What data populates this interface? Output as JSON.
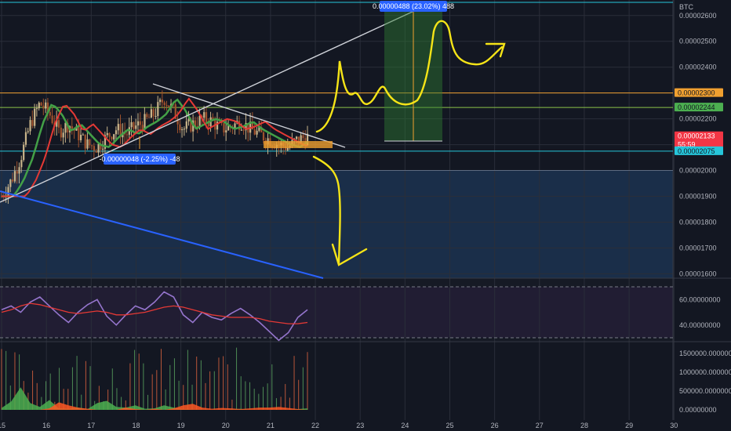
{
  "chart_data": [
    {
      "type": "candlestick",
      "currency_label": "BTC",
      "x_ticks": [
        "15",
        "16",
        "17",
        "18",
        "19",
        "20",
        "21",
        "22",
        "23",
        "24",
        "25",
        "26",
        "27",
        "28",
        "29",
        "30"
      ],
      "y_ticks": [
        "0.00002600",
        "0.00002500",
        "0.00002400",
        "0.00002300",
        "0.00002200",
        "0.00002100",
        "0.00002000",
        "0.00001900",
        "0.00001800",
        "0.00001700",
        "0.00001600"
      ],
      "ylim": [
        1.58e-05,
        2.66e-05
      ],
      "price_tags": [
        {
          "value": "0.00002300",
          "color": "#f0a030",
          "text_color": "#131722"
        },
        {
          "value": "0.00002244",
          "color": "#4caf50",
          "text_color": "#131722"
        },
        {
          "value": "0.00002133",
          "color": "#f23645",
          "text_color": "#ffffff",
          "extra": "55:59"
        },
        {
          "value": "0.00002075",
          "color": "#26c6da",
          "text_color": "#131722"
        }
      ],
      "measure_up": "0.00000488 (23.02%) 488",
      "measure_down": "-0.00000048 (-2.25%) -48",
      "series": [
        {
          "name": "price",
          "close": [
            1.9e-05,
            1.96e-05,
            2.05e-05,
            2.18e-05,
            2.26e-05,
            2.22e-05,
            2.15e-05,
            2.18e-05,
            2.14e-05,
            2.1e-05,
            2.09e-05,
            2.13e-05,
            2.16e-05,
            2.14e-05,
            2.17e-05,
            2.19e-05,
            2.22e-05,
            2.28e-05,
            2.23e-05,
            2.16e-05,
            2.18e-05,
            2.2e-05,
            2.19e-05,
            2.16e-05,
            2.17e-05,
            2.19e-05,
            2.16e-05,
            2.14e-05,
            2.12e-05,
            2.1e-05,
            2.09e-05,
            2.12e-05,
            2.13e-05
          ]
        },
        {
          "name": "ma_fast"
        },
        {
          "name": "ma_slow"
        }
      ]
    },
    {
      "type": "line",
      "y_ticks": [
        "60.00000000",
        "40.00000000"
      ],
      "series": [
        {
          "name": "rsi",
          "values": [
            52,
            55,
            50,
            58,
            62,
            55,
            48,
            42,
            50,
            56,
            60,
            47,
            40,
            48,
            55,
            52,
            58,
            66,
            62,
            48,
            42,
            50,
            46,
            44,
            49,
            53,
            48,
            42,
            35,
            28,
            34,
            46,
            52
          ]
        },
        {
          "name": "rsi_ma",
          "values": [
            50,
            52,
            55,
            57,
            56,
            54,
            52,
            50,
            49,
            50,
            51,
            50,
            48,
            48,
            49,
            50,
            52,
            54,
            55,
            54,
            52,
            50,
            48,
            47,
            46,
            46,
            46,
            45,
            43,
            42,
            41,
            41,
            42
          ]
        }
      ]
    },
    {
      "type": "area",
      "y_ticks": [
        "1500000.00000000",
        "1000000.00000000",
        "500000.00000000",
        "0.00000000"
      ],
      "series": [
        {
          "name": "volume_up",
          "values": [
            50000,
            220000,
            600000,
            180000,
            80000,
            260000,
            40000,
            30000,
            60000,
            20000,
            180000,
            240000,
            80000,
            60000,
            120000,
            30000,
            40000,
            120000,
            60000,
            20000,
            10000,
            5000,
            0,
            0,
            10000,
            30000,
            0,
            0,
            0,
            0,
            0,
            20000,
            40000
          ]
        },
        {
          "name": "volume_down",
          "values": [
            0,
            0,
            0,
            0,
            0,
            40000,
            200000,
            120000,
            60000,
            30000,
            0,
            0,
            0,
            60000,
            20000,
            0,
            30000,
            0,
            40000,
            120000,
            160000,
            60000,
            30000,
            50000,
            40000,
            20000,
            40000,
            60000,
            60000,
            80000,
            50000,
            20000,
            0
          ]
        }
      ]
    }
  ]
}
